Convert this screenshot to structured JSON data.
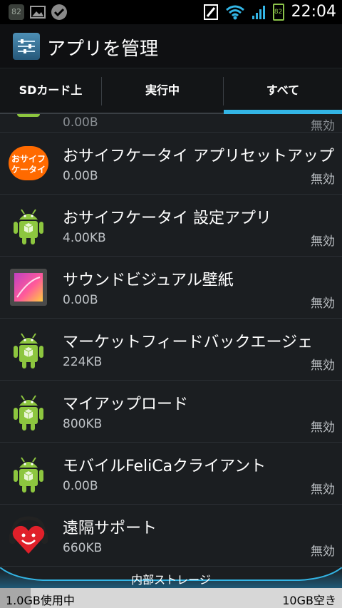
{
  "status_bar": {
    "battery_small": "82",
    "battery": "82",
    "clock": "22:04"
  },
  "action_bar": {
    "title": "アプリを管理"
  },
  "tabs": [
    {
      "label": "SDカード上",
      "selected": false
    },
    {
      "label": "実行中",
      "selected": false
    },
    {
      "label": "すべて",
      "selected": true
    }
  ],
  "partial_item": {
    "size": "0.00B",
    "status": "無効"
  },
  "apps": [
    {
      "name": "おサイフケータイ アプリセットアップ",
      "size": "0.00B",
      "status": "無効",
      "icon": "osaifu-icon"
    },
    {
      "name": "おサイフケータイ 設定アプリ",
      "size": "4.00KB",
      "status": "無効",
      "icon": "android-icon"
    },
    {
      "name": "サウンドビジュアル壁紙",
      "size": "0.00B",
      "status": "無効",
      "icon": "wallpaper-icon"
    },
    {
      "name": "マーケットフィードバックエージェ",
      "size": "224KB",
      "status": "無効",
      "icon": "android-icon"
    },
    {
      "name": "マイアップロード",
      "size": "800KB",
      "status": "無効",
      "icon": "android-icon"
    },
    {
      "name": "モバイルFeliCaクライアント",
      "size": "0.00B",
      "status": "無効",
      "icon": "android-icon"
    },
    {
      "name": "遠隔サポート",
      "size": "660KB",
      "status": "無効",
      "icon": "support-icon"
    }
  ],
  "storage": {
    "label": "内部ストレージ",
    "used": "1.0GB使用中",
    "free": "10GB空き",
    "used_fraction": 0.09
  },
  "colors": {
    "accent": "#33b5e5"
  }
}
